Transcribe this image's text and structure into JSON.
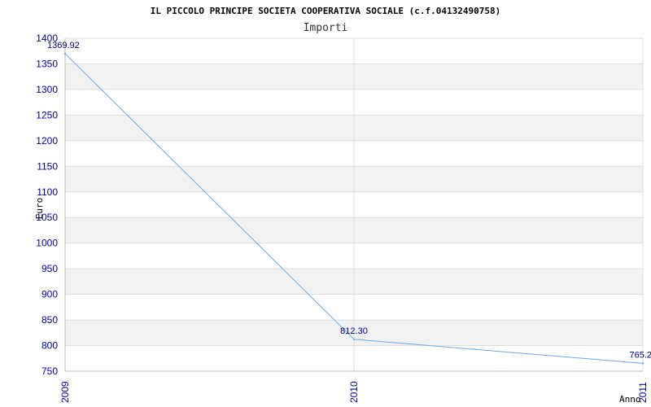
{
  "chart_data": {
    "type": "line",
    "title": "IL PICCOLO PRINCIPE SOCIETA COOPERATIVA SOCIALE (c.f.04132490758)",
    "subtitle": "Importi",
    "xlabel": "Anno",
    "ylabel": "Euro",
    "categories": [
      "2009",
      "2010",
      "2011"
    ],
    "values": [
      1369.92,
      812.3,
      765.2
    ],
    "data_labels": [
      "1369.92",
      "812.30",
      "765.2"
    ],
    "ylim": [
      750,
      1400
    ],
    "yticks": [
      750,
      800,
      850,
      900,
      950,
      1000,
      1050,
      1100,
      1150,
      1200,
      1250,
      1300,
      1350,
      1400
    ],
    "grid": true,
    "colors": {
      "line": "#6aa8e0",
      "band": "#f2f2f2",
      "tick_text": "#0000aa",
      "label_text": "#000080"
    }
  }
}
